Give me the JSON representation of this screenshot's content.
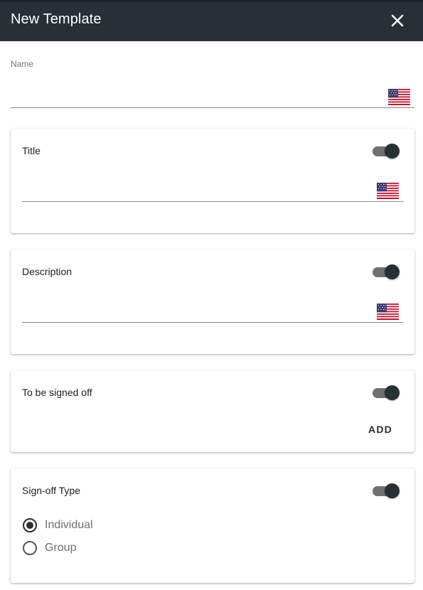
{
  "header": {
    "title": "New Template",
    "close_icon": "close-icon"
  },
  "name_field": {
    "label": "Name",
    "value": "",
    "flag_icon": "us-flag-icon"
  },
  "cards": {
    "title": {
      "label": "Title",
      "enabled": true,
      "value": "",
      "flag_icon": "us-flag-icon"
    },
    "description": {
      "label": "Description",
      "enabled": true,
      "value": "",
      "flag_icon": "us-flag-icon"
    },
    "signed_off": {
      "label": "To be signed off",
      "enabled": true,
      "add_label": "ADD"
    },
    "signoff_type": {
      "label": "Sign-off Type",
      "enabled": true,
      "options": [
        {
          "label": "Individual",
          "selected": true
        },
        {
          "label": "Group",
          "selected": false
        }
      ]
    }
  },
  "colors": {
    "header_bg": "#263035",
    "accent": "#263035",
    "toggle_track": "#707070"
  }
}
